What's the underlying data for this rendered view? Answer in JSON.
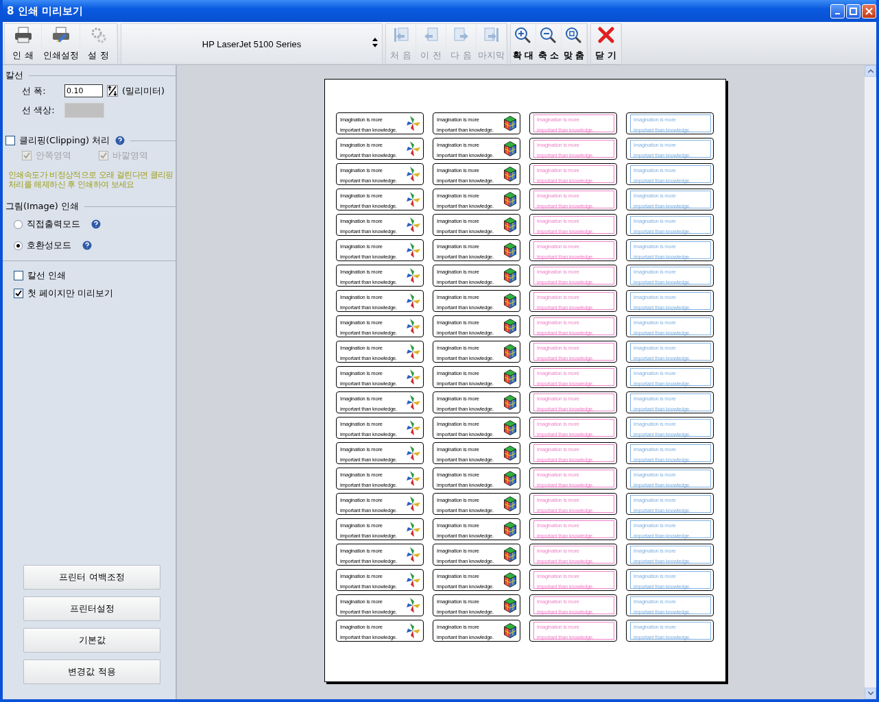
{
  "window": {
    "title": "8 인쇄 미리보기"
  },
  "toolbar": {
    "file_buttons": [
      {
        "label": "인 쇄"
      },
      {
        "label": "인쇄설정"
      },
      {
        "label": "설 정"
      }
    ],
    "printer_select": {
      "value": "HP LaserJet 5100 Series"
    },
    "nav_buttons": [
      {
        "label": "처 음",
        "disabled": true
      },
      {
        "label": "이 전",
        "disabled": true
      },
      {
        "label": "다 음",
        "disabled": true
      },
      {
        "label": "마지막",
        "disabled": true
      }
    ],
    "zoom_buttons": [
      {
        "label": "확 대"
      },
      {
        "label": "축 소"
      },
      {
        "label": "맞 춤"
      }
    ],
    "close_button": {
      "label": "닫 기"
    }
  },
  "settings": {
    "cutline": {
      "title": "칼선",
      "width_label": "선 폭:",
      "width_value": "0.10",
      "unit": "(밀리미터)",
      "color_label": "선 색상:"
    },
    "clipping": {
      "label": "클리핑(Clipping) 처리",
      "checked": false,
      "areas": [
        {
          "label": "안쪽영역",
          "checked": true,
          "disabled": true
        },
        {
          "label": "바깥영역",
          "checked": true,
          "disabled": true
        }
      ],
      "warning": "인쇄속도가 비정상적으로 오래 걸린다면 클리핑처리를 해제하신 후 인쇄하여 보세요"
    },
    "image_print": {
      "title": "그림(Image) 인쇄",
      "modes": [
        {
          "label": "직접출력모드",
          "selected": false
        },
        {
          "label": "호환성모드",
          "selected": true
        }
      ]
    },
    "options": [
      {
        "label": "칼선 인쇄",
        "checked": false
      },
      {
        "label": "첫 페이지만 미리보기",
        "checked": true
      }
    ],
    "buttons": [
      "프린터 여백조정",
      "프린터설정",
      "기본값",
      "변경값 적용"
    ]
  },
  "preview": {
    "rows": [
      [
        {
          "kind": "pinwheel",
          "lines": [
            "Imagination is more",
            "important than knowledge."
          ]
        },
        {
          "kind": "cube",
          "lines": [
            "Imagination is more",
            "important than knowledge."
          ]
        },
        {
          "kind": "framed",
          "color": "#f080c8",
          "lines": [
            "Imagination is more",
            "important than knowledge."
          ]
        },
        {
          "kind": "framed",
          "color": "#80b0e0",
          "lines": [
            "Imagination is more",
            "important than knowledge."
          ]
        }
      ],
      [
        {
          "kind": "pinwheel",
          "lines": [
            "Imagination is more",
            "important than knowledge."
          ]
        },
        {
          "kind": "cube",
          "lines": [
            "Imagination is more",
            "important than knowledge."
          ]
        },
        {
          "kind": "framed",
          "color": "#f080c8",
          "lines": [
            "Imagination is more",
            "important than knowledge."
          ]
        },
        {
          "kind": "framed",
          "color": "#80b0e0",
          "lines": [
            "Imagination is more",
            "important than knowledge."
          ]
        }
      ],
      [
        {
          "kind": "pinwheel",
          "lines": [
            "Imagination is more",
            "important than knowledge."
          ]
        },
        {
          "kind": "cube",
          "lines": [
            "Imagination is more",
            "important than knowledge."
          ]
        },
        {
          "kind": "framed",
          "color": "#f080c8",
          "lines": [
            "Imagination is more",
            "important than knowledge."
          ]
        },
        {
          "kind": "framed",
          "color": "#80b0e0",
          "lines": [
            "Imagination is more",
            "important than knowledge."
          ]
        }
      ],
      [
        {
          "kind": "pinwheel",
          "lines": [
            "Imagination is more",
            "important than knowledge."
          ]
        },
        {
          "kind": "cube",
          "lines": [
            "Imagination is more",
            "important than knowledge."
          ]
        },
        {
          "kind": "framed",
          "color": "#f080c8",
          "lines": [
            "Imagination is more",
            "important than knowledge."
          ]
        },
        {
          "kind": "framed",
          "color": "#80b0e0",
          "lines": [
            "Imagination is more",
            "important than knowledge."
          ]
        }
      ],
      [
        {
          "kind": "pinwheel",
          "lines": [
            "Imagination is more",
            "important than knowledge."
          ]
        },
        {
          "kind": "cube",
          "lines": [
            "Imagination is more",
            "important than knowledge."
          ]
        },
        {
          "kind": "framed",
          "color": "#f080c8",
          "lines": [
            "Imagination is more",
            "important than knowledge."
          ]
        },
        {
          "kind": "framed",
          "color": "#80b0e0",
          "lines": [
            "Imagination is more",
            "important than knowledge."
          ]
        }
      ],
      [
        {
          "kind": "pinwheel",
          "lines": [
            "Imagination is more",
            "important than knowledge."
          ]
        },
        {
          "kind": "cube",
          "lines": [
            "Imagination is more",
            "important than knowledge."
          ]
        },
        {
          "kind": "framed",
          "color": "#f080c8",
          "lines": [
            "Imagination is more",
            "important than knowledge."
          ]
        },
        {
          "kind": "framed",
          "color": "#80b0e0",
          "lines": [
            "Imagination is more",
            "important than knowledge."
          ]
        }
      ],
      [
        {
          "kind": "pinwheel",
          "lines": [
            "Imagination is more",
            "important than knowledge."
          ]
        },
        {
          "kind": "cube",
          "lines": [
            "Imagination is more",
            "important than knowledge."
          ]
        },
        {
          "kind": "framed",
          "color": "#f080c8",
          "lines": [
            "Imagination is more",
            "important than knowledge."
          ]
        },
        {
          "kind": "framed",
          "color": "#80b0e0",
          "lines": [
            "Imagination is more",
            "important than knowledge."
          ]
        }
      ],
      [
        {
          "kind": "pinwheel",
          "lines": [
            "Imagination is more",
            "important than knowledge."
          ]
        },
        {
          "kind": "cube",
          "lines": [
            "Imagination is more",
            "important than knowledge."
          ]
        },
        {
          "kind": "framed",
          "color": "#f080c8",
          "lines": [
            "Imagination is more",
            "important than knowledge."
          ]
        },
        {
          "kind": "framed",
          "color": "#80b0e0",
          "lines": [
            "Imagination is more",
            "important than knowledge."
          ]
        }
      ],
      [
        {
          "kind": "pinwheel",
          "lines": [
            "Imagination is more",
            "important than knowledge."
          ]
        },
        {
          "kind": "cube",
          "lines": [
            "Imagination is more",
            "important than knowledge."
          ]
        },
        {
          "kind": "framed",
          "color": "#f080c8",
          "lines": [
            "Imagination is more",
            "important than knowledge."
          ]
        },
        {
          "kind": "framed",
          "color": "#80b0e0",
          "lines": [
            "Imagination is more",
            "important than knowledge."
          ]
        }
      ],
      [
        {
          "kind": "pinwheel",
          "lines": [
            "Imagination is more",
            "important than knowledge."
          ]
        },
        {
          "kind": "cube",
          "lines": [
            "Imagination is more",
            "important than knowledge."
          ]
        },
        {
          "kind": "framed",
          "color": "#f080c8",
          "lines": [
            "Imagination is more",
            "important than knowledge."
          ]
        },
        {
          "kind": "framed",
          "color": "#80b0e0",
          "lines": [
            "Imagination is more",
            "important than knowledge."
          ]
        }
      ],
      [
        {
          "kind": "pinwheel",
          "lines": [
            "Imagination is more",
            "important than knowledge."
          ]
        },
        {
          "kind": "cube",
          "lines": [
            "Imagination is more",
            "important than knowledge."
          ]
        },
        {
          "kind": "framed",
          "color": "#f080c8",
          "lines": [
            "Imagination is more",
            "important than knowledge."
          ]
        },
        {
          "kind": "framed",
          "color": "#80b0e0",
          "lines": [
            "Imagination is more",
            "important than knowledge."
          ]
        }
      ],
      [
        {
          "kind": "pinwheel",
          "lines": [
            "Imagination is more",
            "important than knowledge."
          ]
        },
        {
          "kind": "cube",
          "lines": [
            "Imagination is more",
            "important than knowledge."
          ]
        },
        {
          "kind": "framed",
          "color": "#f080c8",
          "lines": [
            "Imagination is more",
            "important than knowledge."
          ]
        },
        {
          "kind": "framed",
          "color": "#80b0e0",
          "lines": [
            "Imagination is more",
            "important than knowledge."
          ]
        }
      ],
      [
        {
          "kind": "pinwheel",
          "lines": [
            "Imagination is more",
            "important than knowledge."
          ]
        },
        {
          "kind": "cube",
          "lines": [
            "Imagination is more",
            "important than knowledge."
          ]
        },
        {
          "kind": "framed",
          "color": "#f080c8",
          "lines": [
            "Imagination is more",
            "important than knowledge."
          ]
        },
        {
          "kind": "framed",
          "color": "#80b0e0",
          "lines": [
            "Imagination is more",
            "important than knowledge."
          ]
        }
      ],
      [
        {
          "kind": "pinwheel",
          "lines": [
            "Imagination is more",
            "important than knowledge."
          ]
        },
        {
          "kind": "cube",
          "lines": [
            "Imagination is more",
            "important than knowledge."
          ]
        },
        {
          "kind": "framed",
          "color": "#f080c8",
          "lines": [
            "Imagination is more",
            "important than knowledge."
          ]
        },
        {
          "kind": "framed",
          "color": "#80b0e0",
          "lines": [
            "Imagination is more",
            "important than knowledge."
          ]
        }
      ],
      [
        {
          "kind": "pinwheel",
          "lines": [
            "Imagination is more",
            "important than knowledge."
          ]
        },
        {
          "kind": "cube",
          "lines": [
            "Imagination is more",
            "important than knowledge."
          ]
        },
        {
          "kind": "framed",
          "color": "#f080c8",
          "lines": [
            "Imagination is more",
            "important than knowledge."
          ]
        },
        {
          "kind": "framed",
          "color": "#80b0e0",
          "lines": [
            "Imagination is more",
            "important than knowledge."
          ]
        }
      ],
      [
        {
          "kind": "pinwheel",
          "lines": [
            "Imagination is more",
            "important than knowledge."
          ]
        },
        {
          "kind": "cube",
          "lines": [
            "Imagination is more",
            "important than knowledge."
          ]
        },
        {
          "kind": "framed",
          "color": "#f080c8",
          "lines": [
            "Imagination is more",
            "important than knowledge."
          ]
        },
        {
          "kind": "framed",
          "color": "#80b0e0",
          "lines": [
            "Imagination is more",
            "important than knowledge."
          ]
        }
      ],
      [
        {
          "kind": "pinwheel",
          "lines": [
            "Imagination is more",
            "important than knowledge."
          ]
        },
        {
          "kind": "cube",
          "lines": [
            "Imagination is more",
            "important than knowledge."
          ]
        },
        {
          "kind": "framed",
          "color": "#f080c8",
          "lines": [
            "Imagination is more",
            "important than knowledge."
          ]
        },
        {
          "kind": "framed",
          "color": "#80b0e0",
          "lines": [
            "Imagination is more",
            "important than knowledge."
          ]
        }
      ],
      [
        {
          "kind": "pinwheel",
          "lines": [
            "Imagination is more",
            "important than knowledge."
          ]
        },
        {
          "kind": "cube",
          "lines": [
            "Imagination is more",
            "important than knowledge."
          ]
        },
        {
          "kind": "framed",
          "color": "#f080c8",
          "lines": [
            "Imagination is more",
            "important than knowledge."
          ]
        },
        {
          "kind": "framed",
          "color": "#80b0e0",
          "lines": [
            "Imagination is more",
            "important than knowledge."
          ]
        }
      ],
      [
        {
          "kind": "pinwheel",
          "lines": [
            "Imagination is more",
            "important than knowledge."
          ]
        },
        {
          "kind": "cube",
          "lines": [
            "Imagination is more",
            "important than knowledge."
          ]
        },
        {
          "kind": "framed",
          "color": "#f080c8",
          "lines": [
            "Imagination is more",
            "important than knowledge."
          ]
        },
        {
          "kind": "framed",
          "color": "#80b0e0",
          "lines": [
            "Imagination is more",
            "important than knowledge."
          ]
        }
      ],
      [
        {
          "kind": "pinwheel",
          "lines": [
            "Imagination is more",
            "important than knowledge."
          ]
        },
        {
          "kind": "cube",
          "lines": [
            "Imagination is more",
            "important than knowledge."
          ]
        },
        {
          "kind": "framed",
          "color": "#f080c8",
          "lines": [
            "Imagination is more",
            "important than knowledge."
          ]
        },
        {
          "kind": "framed",
          "color": "#80b0e0",
          "lines": [
            "Imagination is more",
            "important than knowledge."
          ]
        }
      ],
      [
        {
          "kind": "pinwheel",
          "lines": [
            "Imagination is more",
            "important than knowledge."
          ]
        },
        {
          "kind": "cube",
          "lines": [
            "Imagination is more",
            "important than knowledge."
          ]
        },
        {
          "kind": "framed",
          "color": "#f080c8",
          "lines": [
            "Imagination is more",
            "important than knowledge."
          ]
        },
        {
          "kind": "framed",
          "color": "#80b0e0",
          "lines": [
            "Imagination is more",
            "important than knowledge."
          ]
        }
      ]
    ]
  }
}
